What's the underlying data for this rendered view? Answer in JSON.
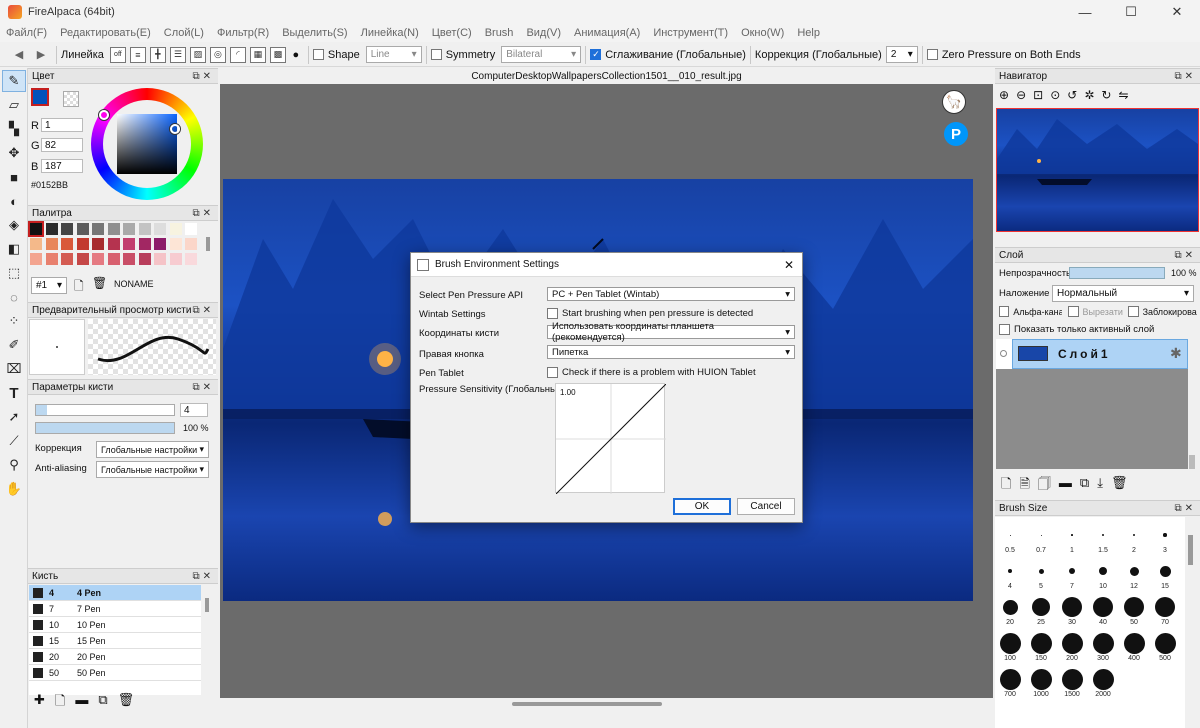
{
  "window": {
    "title": "FireAlpaca (64bit)",
    "min": "—",
    "max": "☐",
    "close": "✕"
  },
  "menu": [
    "Файл(F)",
    "Редактировать(E)",
    "Слой(L)",
    "Фильтр(R)",
    "Выделить(S)",
    "Линейка(N)",
    "Цвет(C)",
    "Brush",
    "Вид(V)",
    "Анимация(A)",
    "Инструмент(T)",
    "Окно(W)",
    "Help"
  ],
  "toolbar": {
    "ruler_label": "Линейка",
    "ruler_off": "off",
    "shape_label": "Shape",
    "shape_value": "Line",
    "symmetry_label": "Symmetry",
    "symmetry_value": "Bilateral",
    "smoothing_label": "Сглаживание (Глобальные)",
    "correction_label": "Коррекция (Глобальные)",
    "correction_value": "2",
    "zero_pressure_label": "Zero Pressure on Both Ends"
  },
  "color_panel": {
    "title": "Цвет",
    "r_label": "R",
    "r": "1",
    "g_label": "G",
    "g": "82",
    "b_label": "B",
    "b": "187",
    "hex": "#0152BB",
    "current_color": "#0152bb"
  },
  "palette_panel": {
    "title": "Палитра",
    "index": "#1",
    "name": "NONAME",
    "rows": [
      [
        "#111111",
        "#2b2b2b",
        "#444444",
        "#5c5c5c",
        "#767676",
        "#8f8f8f",
        "#a9a9a9",
        "#c3c3c3",
        "#dddddd",
        "#f7f3e0",
        "#ffffff"
      ],
      [
        "#f4b98a",
        "#e8865a",
        "#d9593a",
        "#c23a2e",
        "#a72b2e",
        "#b5334f",
        "#c23d6e",
        "#a22763",
        "#8c1c6a",
        "#fde5d6",
        "#fbd6c9"
      ],
      [
        "#f3a48f",
        "#e8806e",
        "#d45b52",
        "#c54747",
        "#e57a82",
        "#d8606f",
        "#c94e67",
        "#b83d5b",
        "#f5c3c7",
        "#f7cbd0",
        "#f9d9dc"
      ]
    ]
  },
  "brush_preview": {
    "title": "Предварительный просмотр кисти"
  },
  "brush_params": {
    "title": "Параметры кисти",
    "size": "4",
    "opacity": "100 %",
    "correction_label": "Коррекция",
    "correction_value": "Глобальные настройки",
    "aa_label": "Anti-aliasing",
    "aa_value": "Глобальные настройки"
  },
  "brush_list": {
    "title": "Кисть",
    "items": [
      {
        "num": "4",
        "name": "4  Pen"
      },
      {
        "num": "7",
        "name": "7  Pen"
      },
      {
        "num": "10",
        "name": "10  Pen"
      },
      {
        "num": "15",
        "name": "15  Pen"
      },
      {
        "num": "20",
        "name": "20  Pen"
      },
      {
        "num": "50",
        "name": "50  Pen"
      }
    ]
  },
  "document": {
    "tab": "ComputerDesktopWallpapersCollection1501__010_result.jpg"
  },
  "dialog": {
    "title": "Brush Environment Settings",
    "close": "✕",
    "rows": {
      "api_label": "Select Pen Pressure API",
      "api_value": "PC + Pen Tablet (Wintab)",
      "wintab_label": "Wintab Settings",
      "wintab_check": "Start brushing when pen pressure is detected",
      "coords_label": "Координаты кисти",
      "coords_value": "Использовать координаты планшета (рекомендуется)",
      "right_label": "Правая кнопка",
      "right_value": "Пипетка",
      "pentablet_label": "Pen Tablet",
      "pentablet_check": "Check if there is a problem with HUION Tablet",
      "pressure_label": "Pressure Sensitivity (Глобальные)",
      "curve_value": "1.00"
    },
    "ok": "OK",
    "cancel": "Cancel"
  },
  "navigator": {
    "title": "Навигатор"
  },
  "layer_panel": {
    "title": "Слой",
    "opacity_label": "Непрозрачность",
    "opacity_value": "100 %",
    "blend_label": "Наложение",
    "blend_value": "Нормальный",
    "alpha_label": "Альфа-кана",
    "clip_label": "Вырезати",
    "lock_label": "Заблокирова",
    "only_active_label": "Показать только активный слой",
    "layer_name": "Слой1"
  },
  "brush_size": {
    "title": "Brush Size",
    "sizes": [
      "0.5",
      "0.7",
      "1",
      "1.5",
      "2",
      "3",
      "4",
      "5",
      "7",
      "10",
      "12",
      "15",
      "20",
      "25",
      "30",
      "40",
      "50",
      "70",
      "100",
      "150",
      "200",
      "300",
      "400",
      "500",
      "700",
      "1000",
      "1500",
      "2000"
    ]
  }
}
